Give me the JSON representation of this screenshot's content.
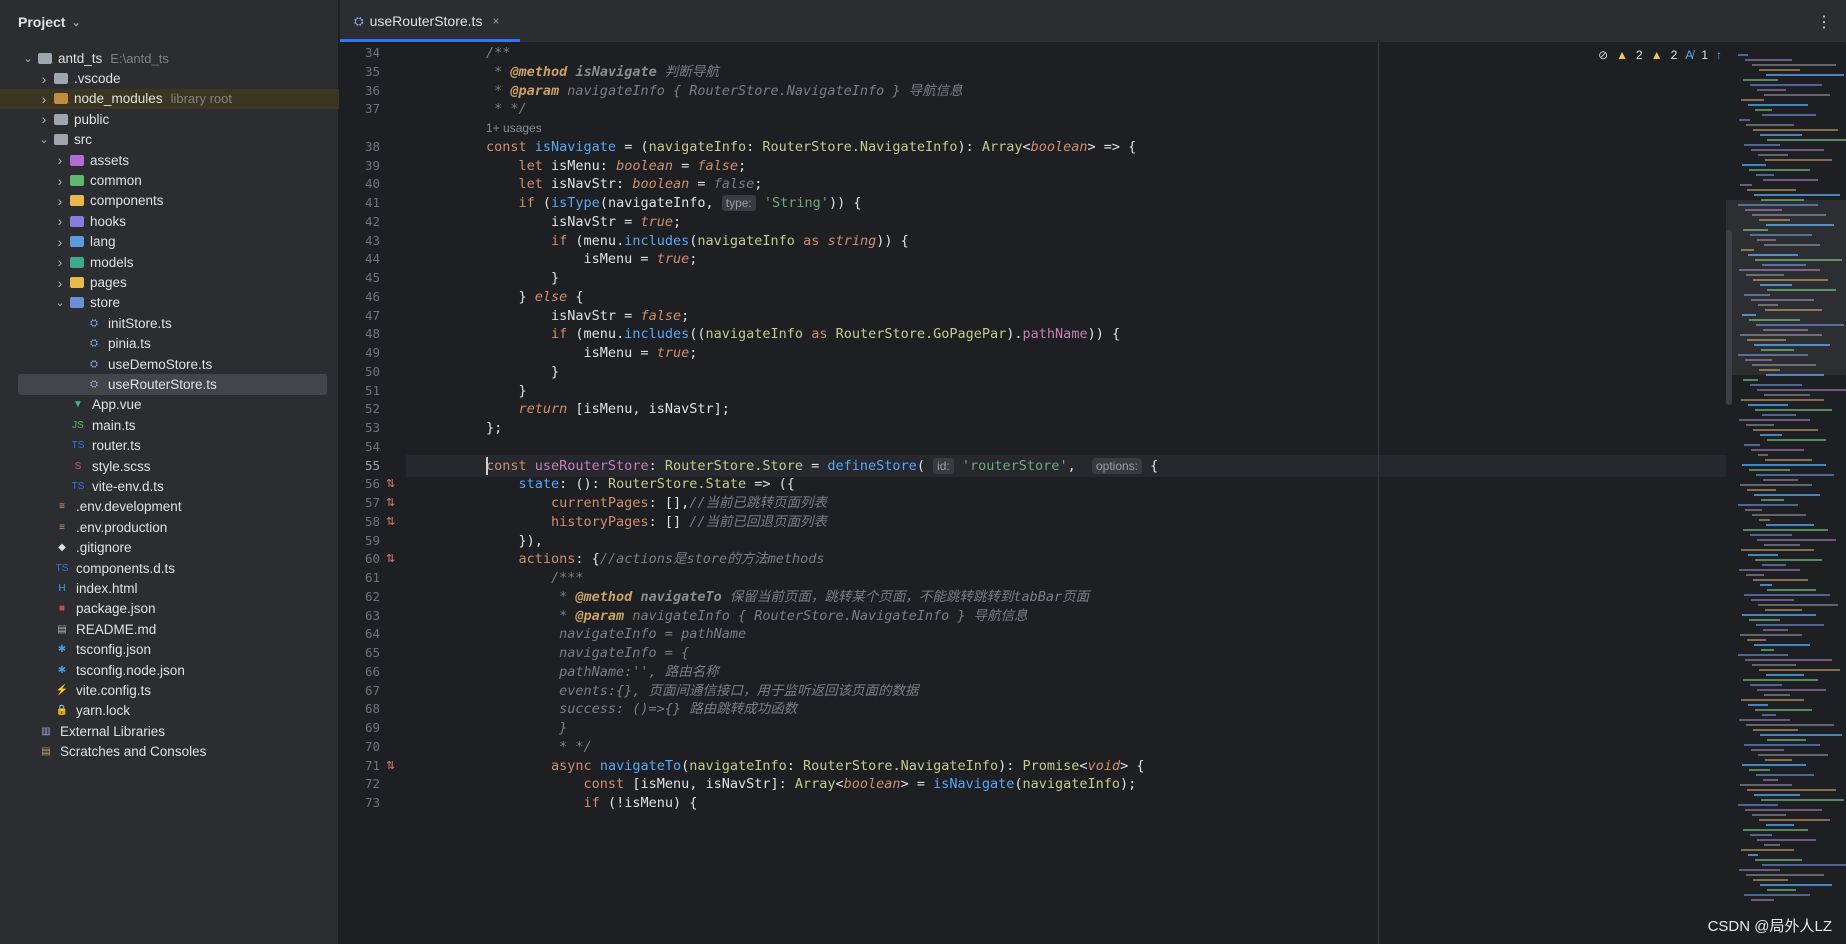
{
  "sidebar": {
    "title": "Project",
    "tree": [
      {
        "label": "antd_ts",
        "extra": "E:\\antd_ts",
        "indent": 0,
        "arrow": "open",
        "icon": "folder"
      },
      {
        "label": ".vscode",
        "indent": 1,
        "arrow": "closed",
        "icon": "folder"
      },
      {
        "label": "node_modules",
        "extra": "library root",
        "indent": 1,
        "arrow": "closed",
        "icon": "folder-lib",
        "highlight": true
      },
      {
        "label": "public",
        "indent": 1,
        "arrow": "closed",
        "icon": "folder"
      },
      {
        "label": "src",
        "indent": 1,
        "arrow": "open",
        "icon": "folder"
      },
      {
        "label": "assets",
        "indent": 2,
        "arrow": "closed",
        "icon": "folder-assets"
      },
      {
        "label": "common",
        "indent": 2,
        "arrow": "closed",
        "icon": "folder-common"
      },
      {
        "label": "components",
        "indent": 2,
        "arrow": "closed",
        "icon": "folder-components"
      },
      {
        "label": "hooks",
        "indent": 2,
        "arrow": "closed",
        "icon": "folder-hooks"
      },
      {
        "label": "lang",
        "indent": 2,
        "arrow": "closed",
        "icon": "folder-lang"
      },
      {
        "label": "models",
        "indent": 2,
        "arrow": "closed",
        "icon": "folder-models"
      },
      {
        "label": "pages",
        "indent": 2,
        "arrow": "closed",
        "icon": "folder-pages"
      },
      {
        "label": "store",
        "indent": 2,
        "arrow": "open",
        "icon": "folder-store"
      },
      {
        "label": "initStore.ts",
        "indent": 3,
        "icon": "pinia-file"
      },
      {
        "label": "pinia.ts",
        "indent": 3,
        "icon": "pinia-file"
      },
      {
        "label": "useDemoStore.ts",
        "indent": 3,
        "icon": "pinia-file"
      },
      {
        "label": "useRouterStore.ts",
        "indent": 3,
        "icon": "pinia-file",
        "selected": true
      },
      {
        "label": "App.vue",
        "indent": 2,
        "icon": "vue-file"
      },
      {
        "label": "main.ts",
        "indent": 2,
        "icon": "js-file"
      },
      {
        "label": "router.ts",
        "indent": 2,
        "icon": "ts-file"
      },
      {
        "label": "style.scss",
        "indent": 2,
        "icon": "scss-file"
      },
      {
        "label": "vite-env.d.ts",
        "indent": 2,
        "icon": "ts-file"
      },
      {
        "label": ".env.development",
        "indent": 1,
        "icon": "env-file"
      },
      {
        "label": ".env.production",
        "indent": 1,
        "icon": "env-file"
      },
      {
        "label": ".gitignore",
        "indent": 1,
        "icon": "git-file"
      },
      {
        "label": "components.d.ts",
        "indent": 1,
        "icon": "ts-file"
      },
      {
        "label": "index.html",
        "indent": 1,
        "icon": "html-file"
      },
      {
        "label": "package.json",
        "indent": 1,
        "icon": "npm-file"
      },
      {
        "label": "README.md",
        "indent": 1,
        "icon": "md-file"
      },
      {
        "label": "tsconfig.json",
        "indent": 1,
        "icon": "tsconfig-file"
      },
      {
        "label": "tsconfig.node.json",
        "indent": 1,
        "icon": "tsconfig-file"
      },
      {
        "label": "vite.config.ts",
        "indent": 1,
        "icon": "vite-file"
      },
      {
        "label": "yarn.lock",
        "indent": 1,
        "icon": "lock-file"
      },
      {
        "label": "External Libraries",
        "indent": 0,
        "icon": "library-icon"
      },
      {
        "label": "Scratches and Consoles",
        "indent": 0,
        "icon": "scratches-icon"
      }
    ]
  },
  "tab": {
    "title": "useRouterStore.ts",
    "close": "×"
  },
  "toolbar": {
    "more": "⋮"
  },
  "inspections": {
    "warn1": "2",
    "warn2": "2",
    "typo": "1"
  },
  "editor": {
    "current_line": "55",
    "usages": "1+ usages",
    "lines": [
      {
        "n": "34",
        "html": "<span class=\"cm\">/**</span>"
      },
      {
        "n": "35",
        "html": "<span class=\"cm\"> * </span><span class=\"tag\">@method</span><span class=\"cm\"> <b style=\"color:#8c8c8c\">isNavigate</b> 判断导航</span>"
      },
      {
        "n": "36",
        "html": "<span class=\"cm\"> * </span><span class=\"tag\">@param</span><span class=\"cm\"> navigateInfo { RouterStore.NavigateInfo } 导航信息</span>"
      },
      {
        "n": "37",
        "html": "<span class=\"cm\"> * */</span>"
      },
      {
        "n": "38",
        "html": "<span class=\"kw\">const</span> <span class=\"fn\">isNavigate</span> = (<span class=\"ty\">navigateInfo</span>: <span class=\"ty\">RouterStore.NavigateInfo</span>): <span class=\"ty\">Array</span>&lt;<span class=\"kw ital\">boolean</span>&gt; =&gt; {"
      },
      {
        "n": "39",
        "html": "    <span class=\"kw\">let</span> isMenu: <span class=\"kw ital\">boolean</span> = <span class=\"kw ital\">false</span>;"
      },
      {
        "n": "40",
        "html": "    <span class=\"kw\">let</span> isNavStr: <span class=\"kw ital\">boolean</span> = <span class=\"cm\">false</span>;"
      },
      {
        "n": "41",
        "html": "    <span class=\"kw\">if</span> (<span class=\"fn\">isType</span>(navigateInfo, <span class=\"hint\">type:</span> <span class=\"st\">'String'</span>)) {"
      },
      {
        "n": "42",
        "html": "        isNavStr = <span class=\"kw ital\">true</span>;"
      },
      {
        "n": "43",
        "html": "        <span class=\"kw\">if</span> (menu.<span class=\"fn\">includes</span>(<span class=\"ty\">navigateInfo</span> <span class=\"kw\">as</span> <span class=\"kw ital\">string</span>)) {"
      },
      {
        "n": "44",
        "html": "            isMenu = <span class=\"kw ital\">true</span>;"
      },
      {
        "n": "45",
        "html": "        }"
      },
      {
        "n": "46",
        "html": "    } <span class=\"kw ital\">else</span> {"
      },
      {
        "n": "47",
        "html": "        isNavStr = <span class=\"kw ital\">false</span>;"
      },
      {
        "n": "48",
        "html": "        <span class=\"kw\">if</span> (menu.<span class=\"fn\">includes</span>((<span class=\"ty\">navigateInfo</span> <span class=\"kw\">as</span> <span class=\"ty\">RouterStore.GoPagePar</span>).<span class=\"pr\">pathName</span>)) {"
      },
      {
        "n": "49",
        "html": "            isMenu = <span class=\"kw ital\">true</span>;"
      },
      {
        "n": "50",
        "html": "        }"
      },
      {
        "n": "51",
        "html": "    }"
      },
      {
        "n": "52",
        "html": "    <span class=\"kw ital\">return</span> [isMenu, isNavStr];"
      },
      {
        "n": "53",
        "html": "};"
      },
      {
        "n": "54",
        "html": ""
      },
      {
        "n": "55",
        "html": "<span class=\"kw\">const</span> <span class=\"kw\" style=\"color:#c77dbb\">useRouterStore</span>: <span class=\"ty\">RouterStore.Store</span> = <span class=\"fn\">defineStore</span>( <span class=\"hint\">id:</span> <span class=\"st\">'routerStore'</span>,  <span class=\"hint\">options:</span> {"
      },
      {
        "n": "56",
        "html": "    <span class=\"fn\">state</span>: (): <span class=\"ty\">RouterStore.State</span> =&gt; ({",
        "mark": true
      },
      {
        "n": "57",
        "html": "        <span class=\"kw\">currentPages</span>: [],<span class=\"cm\">//当前已跳转页面列表</span>",
        "mark": true
      },
      {
        "n": "58",
        "html": "        <span class=\"kw\">historyPages</span>: [] <span class=\"cm\">//当前已回退页面列表</span>",
        "mark": true
      },
      {
        "n": "59",
        "html": "    }),"
      },
      {
        "n": "60",
        "html": "    <span class=\"kw\">actions</span>: {<span class=\"cm\">//actions是store的方法methods</span>",
        "mark": true
      },
      {
        "n": "61",
        "html": "        <span class=\"cm\">/***</span>"
      },
      {
        "n": "62",
        "html": "<span class=\"cm\">         * </span><span class=\"tag\">@method</span><span class=\"cm\"> <b style=\"color:#8c8c8c\">navigateTo</b> 保留当前页面，跳转某个页面，不能跳转跳转到tabBar页面</span>"
      },
      {
        "n": "63",
        "html": "<span class=\"cm\">         * </span><span class=\"tag\">@param</span><span class=\"cm\"> navigateInfo { RouterStore.NavigateInfo } 导航信息</span>"
      },
      {
        "n": "64",
        "html": "<span class=\"cm\">         navigateInfo = pathName</span>"
      },
      {
        "n": "65",
        "html": "<span class=\"cm\">         navigateInfo = {</span>"
      },
      {
        "n": "66",
        "html": "<span class=\"cm\">         pathName:'', 路由名称</span>"
      },
      {
        "n": "67",
        "html": "<span class=\"cm\">         events:{}, 页面间通信接口，用于监听返回该页面的数据</span>"
      },
      {
        "n": "68",
        "html": "<span class=\"cm\">         success: ()=&gt;{} 路由跳转成功函数</span>"
      },
      {
        "n": "69",
        "html": "<span class=\"cm\">         }</span>"
      },
      {
        "n": "70",
        "html": "<span class=\"cm\">         * */</span>"
      },
      {
        "n": "71",
        "html": "        <span class=\"kw\">async</span> <span class=\"fn\">navigateTo</span>(<span class=\"ty\">navigateInfo</span>: <span class=\"ty\">RouterStore.NavigateInfo</span>): <span class=\"ty\">Promise</span>&lt;<span class=\"kw ital\">void</span>&gt; {",
        "mark": true
      },
      {
        "n": "72",
        "html": "            <span class=\"kw\">const</span> [isMenu, isNavStr]: <span class=\"ty\">Array</span>&lt;<span class=\"kw ital\">boolean</span>&gt; = <span class=\"fn\">isNavigate</span>(<span class=\"ty\">navigateInfo</span>);"
      },
      {
        "n": "73",
        "html": "            <span class=\"kw\">if</span> (!isMenu) {"
      }
    ]
  },
  "watermark": "CSDN @局外人LZ",
  "colors": {
    "accent": "#3574f0",
    "keyword": "#cf8e6d",
    "function": "#56a8f5",
    "string": "#6aab73",
    "comment": "#7a7e85"
  }
}
